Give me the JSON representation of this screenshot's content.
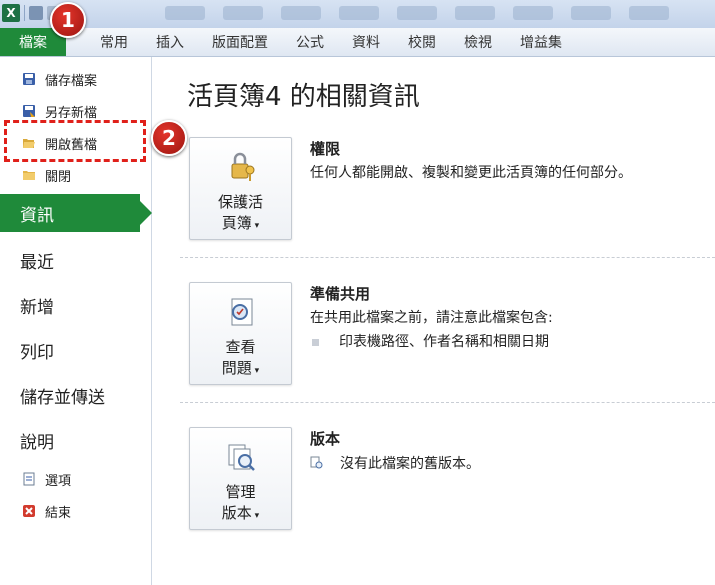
{
  "ribbon": {
    "file_tab": "檔案",
    "tabs": [
      "常用",
      "插入",
      "版面配置",
      "公式",
      "資料",
      "校閱",
      "檢視",
      "增益集"
    ]
  },
  "badges": [
    "1",
    "2"
  ],
  "sidebar": {
    "save": "儲存檔案",
    "save_as": "另存新檔",
    "open": "開啟舊檔",
    "close": "關閉",
    "info": "資訊",
    "recent": "最近",
    "new": "新增",
    "print": "列印",
    "save_send": "儲存並傳送",
    "help": "說明",
    "options": "選項",
    "exit": "結束"
  },
  "main": {
    "title": "活頁簿4 的相關資訊",
    "permissions": {
      "button_line1": "保護活",
      "button_line2": "頁簿",
      "heading": "權限",
      "text": "任何人都能開啟、複製和變更此活頁簿的任何部分。"
    },
    "prepare": {
      "button_line1": "查看",
      "button_line2": "問題",
      "heading": "準備共用",
      "text": "在共用此檔案之前，請注意此檔案包含:",
      "bullet": "印表機路徑、作者名稱和相關日期"
    },
    "versions": {
      "button_line1": "管理",
      "button_line2": "版本",
      "heading": "版本",
      "text": "沒有此檔案的舊版本。"
    }
  },
  "colors": {
    "accent_green": "#1f8a3a",
    "badge_red": "#c7231b",
    "dash_red": "#e0201a"
  },
  "icons": [
    "excel-icon",
    "save-icon",
    "undo-icon",
    "save-disk-icon",
    "save-as-icon",
    "open-folder-icon",
    "close-folder-icon",
    "options-icon",
    "exit-icon",
    "lock-keys-icon",
    "inspect-doc-icon",
    "versions-icon"
  ]
}
